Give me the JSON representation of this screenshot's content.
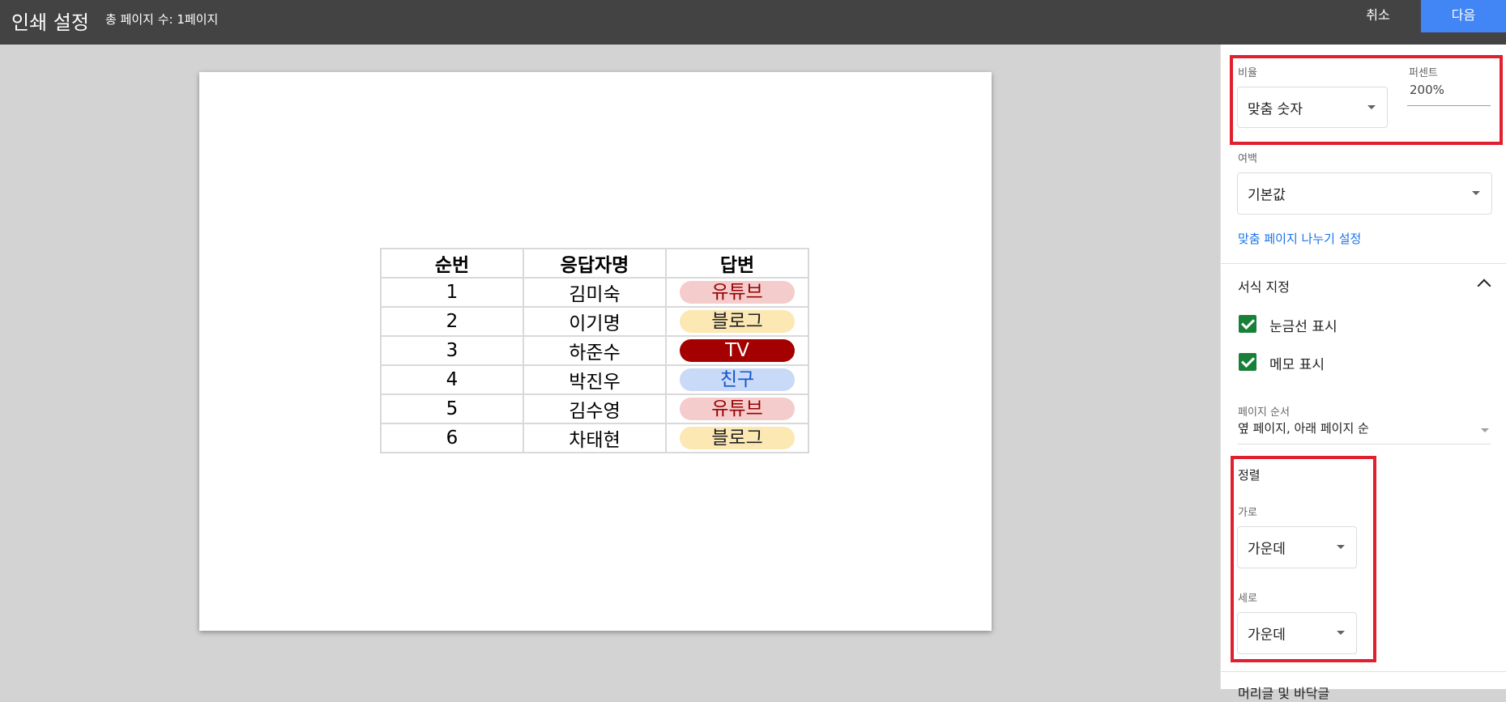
{
  "header": {
    "title": "인쇄 설정",
    "page_count": "총 페이지 수: 1페이지",
    "cancel_label": "취소",
    "next_label": "다음"
  },
  "sheet": {
    "headers": [
      "순번",
      "응답자명",
      "답변"
    ],
    "rows": [
      {
        "no": "1",
        "name": "김미숙",
        "answer": "유튜브"
      },
      {
        "no": "2",
        "name": "이기명",
        "answer": "블로그"
      },
      {
        "no": "3",
        "name": "하준수",
        "answer": "TV"
      },
      {
        "no": "4",
        "name": "박진우",
        "answer": "친구"
      },
      {
        "no": "5",
        "name": "김수영",
        "answer": "유튜브"
      },
      {
        "no": "6",
        "name": "차태현",
        "answer": "블로그"
      }
    ],
    "chip_colors": {
      "유튜브": {
        "bg": "#f4cccc",
        "fg": "#990000"
      },
      "블로그": {
        "bg": "#fce8b2",
        "fg": "#202124"
      },
      "TV": {
        "bg": "#a50000",
        "fg": "#ffffff"
      },
      "친구": {
        "bg": "#c9daf8",
        "fg": "#1155cc"
      }
    }
  },
  "panel": {
    "scale": {
      "label": "비율",
      "value": "맞춤 숫자"
    },
    "percent": {
      "label": "퍼센트",
      "value": "200%"
    },
    "margins": {
      "label": "여백",
      "value": "기본값"
    },
    "custom_breaks_link": "맞춤 페이지 나누기 설정",
    "formatting": {
      "title": "서식 지정",
      "show_gridlines": "눈금선 표시",
      "show_notes": "메모 표시"
    },
    "page_order": {
      "label": "페이지 순서",
      "value": "옆 페이지, 아래 페이지 순"
    },
    "alignment": {
      "title": "정렬",
      "horizontal_label": "가로",
      "horizontal_value": "가운데",
      "vertical_label": "세로",
      "vertical_value": "가운데"
    },
    "next_section_partial": "머리글 및 바닥글"
  },
  "colors": {
    "topbar": "#434343",
    "accent": "#4285f4",
    "highlight_box": "#e0202e",
    "checkbox": "#188038"
  }
}
